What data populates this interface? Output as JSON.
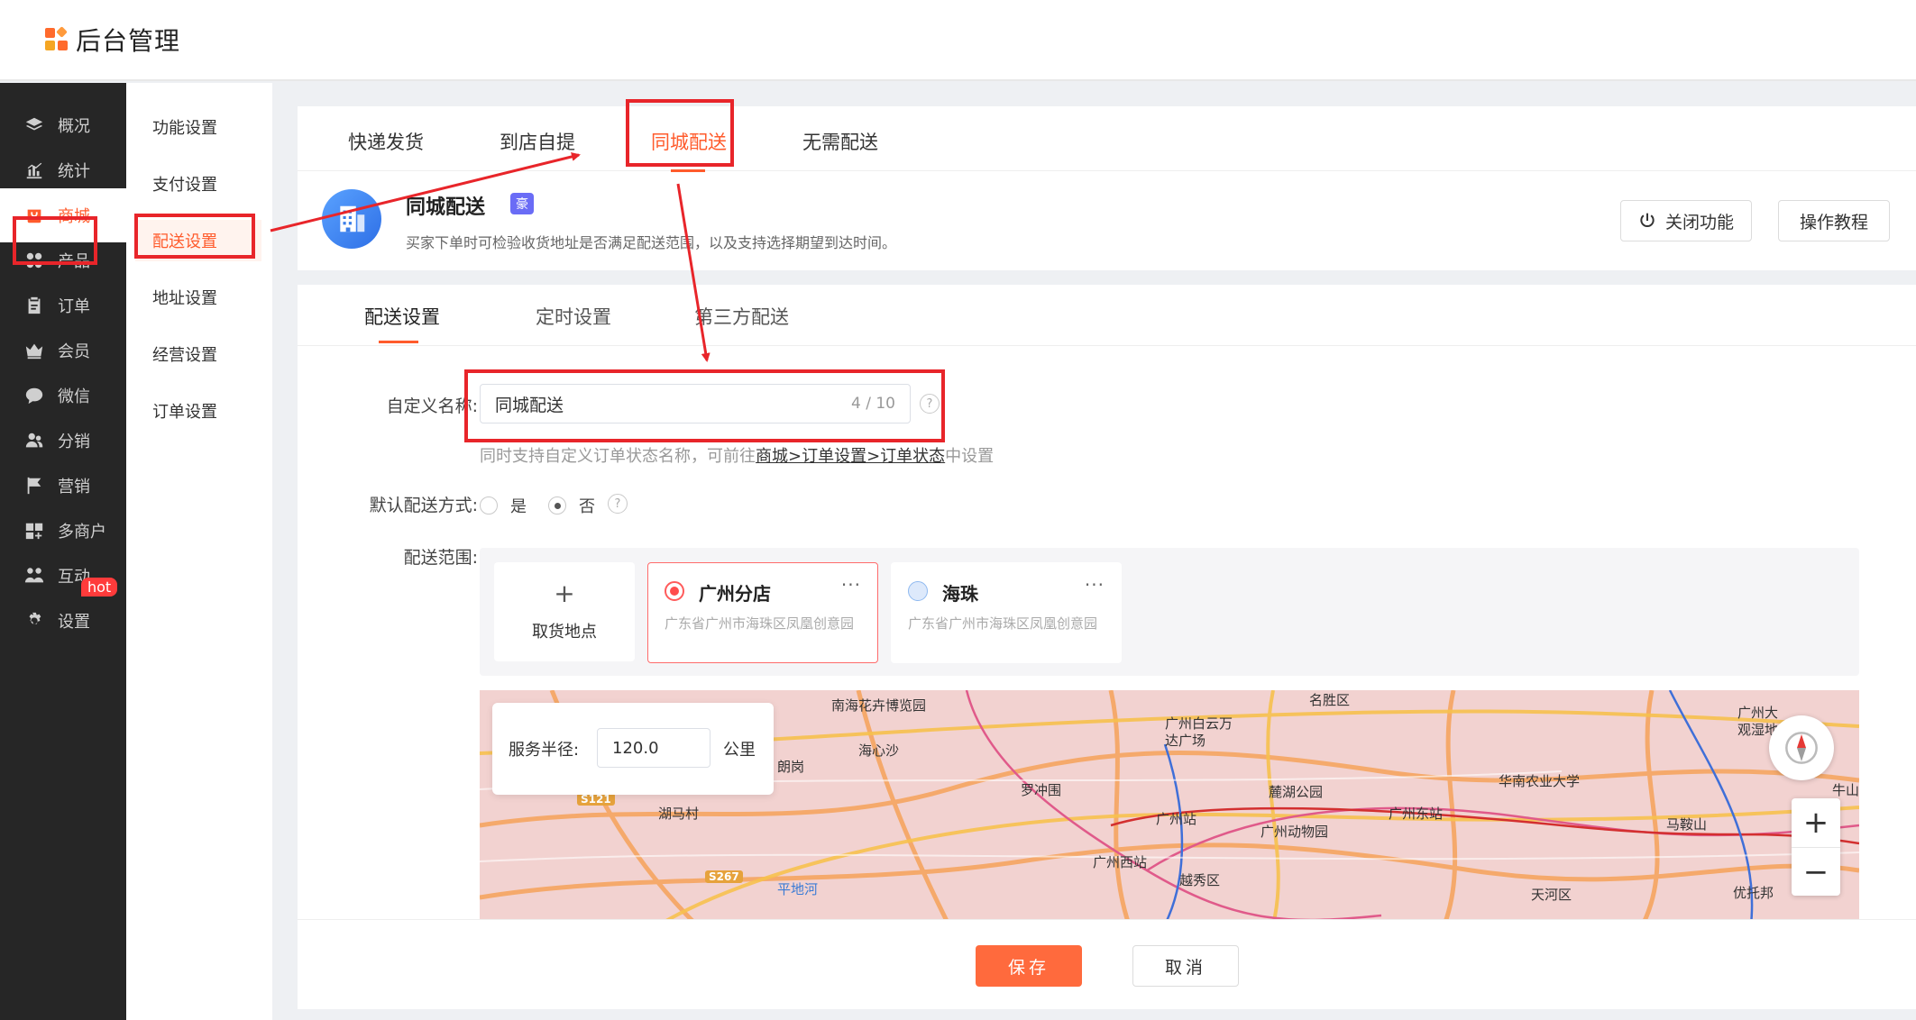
{
  "app": {
    "title": "后台管理"
  },
  "sidebar": {
    "items": [
      {
        "label": "概况",
        "icon": "layers-icon"
      },
      {
        "label": "统计",
        "icon": "chart-icon"
      },
      {
        "label": "商城",
        "icon": "shop-icon",
        "active": true
      },
      {
        "label": "产品",
        "icon": "grid-icon"
      },
      {
        "label": "订单",
        "icon": "clipboard-icon"
      },
      {
        "label": "会员",
        "icon": "crown-icon"
      },
      {
        "label": "微信",
        "icon": "wechat-icon"
      },
      {
        "label": "分销",
        "icon": "users-icon"
      },
      {
        "label": "营销",
        "icon": "flag-icon",
        "badge": "hot"
      },
      {
        "label": "多商户",
        "icon": "store-plus-icon"
      },
      {
        "label": "互动",
        "icon": "people-icon"
      },
      {
        "label": "设置",
        "icon": "gear-icon"
      }
    ]
  },
  "submenu": {
    "items": [
      "功能设置",
      "支付设置",
      "配送设置",
      "地址设置",
      "经营设置",
      "订单设置"
    ],
    "active": "配送设置"
  },
  "delivery_tabs": [
    "快递发货",
    "到店自提",
    "同城配送",
    "无需配送"
  ],
  "feature": {
    "title": "同城配送",
    "badge": "豪",
    "description": "买家下单时可检验收货地址是否满足配送范围，以及支持选择期望到达时间。",
    "close_button": "关闭功能",
    "tutorial_button": "操作教程"
  },
  "sub_tabs": [
    "配送设置",
    "定时设置",
    "第三方配送"
  ],
  "form": {
    "name_label": "自定义名称:",
    "name_value": "同城配送",
    "name_count": "4 / 10",
    "hint_prefix": "同时支持自定义订单状态名称，可前往",
    "hint_link": "商城>订单设置>订单状态",
    "hint_suffix": "中设置",
    "default_label": "默认配送方式:",
    "default_yes": "是",
    "default_no": "否",
    "range_label": "配送范围:",
    "pickup_plus": "+",
    "pickup_label": "取货地点",
    "stores": [
      {
        "name": "广州分店",
        "address": "广东省广州市海珠区凤凰创意园",
        "selected": true
      },
      {
        "name": "海珠",
        "address": "广东省广州市海珠区凤凰创意园",
        "selected": false
      }
    ],
    "more": "···"
  },
  "map": {
    "radius_label": "服务半径:",
    "radius_value": "120.0",
    "radius_unit": "公里",
    "labels": [
      "南海花卉博览园",
      "海心沙",
      "罗冲围",
      "广州白云万达广场",
      "名胜区",
      "广州大观湿地",
      "麓湖公园",
      "广州站",
      "广州东站",
      "华南农业大学",
      "马鞍山",
      "广州西站",
      "广州动物园",
      "越秀区",
      "天河区",
      "平地河",
      "湖马村",
      "朗岗",
      "牛山",
      "优托邦"
    ],
    "road_tags": [
      "S121",
      "S267"
    ],
    "zoom_in": "+",
    "zoom_out": "−"
  },
  "footer": {
    "save": "保存",
    "cancel": "取消"
  },
  "colors": {
    "accent": "#ff5b2c",
    "annotation": "#e8252a",
    "sidebar_bg": "#262626"
  }
}
